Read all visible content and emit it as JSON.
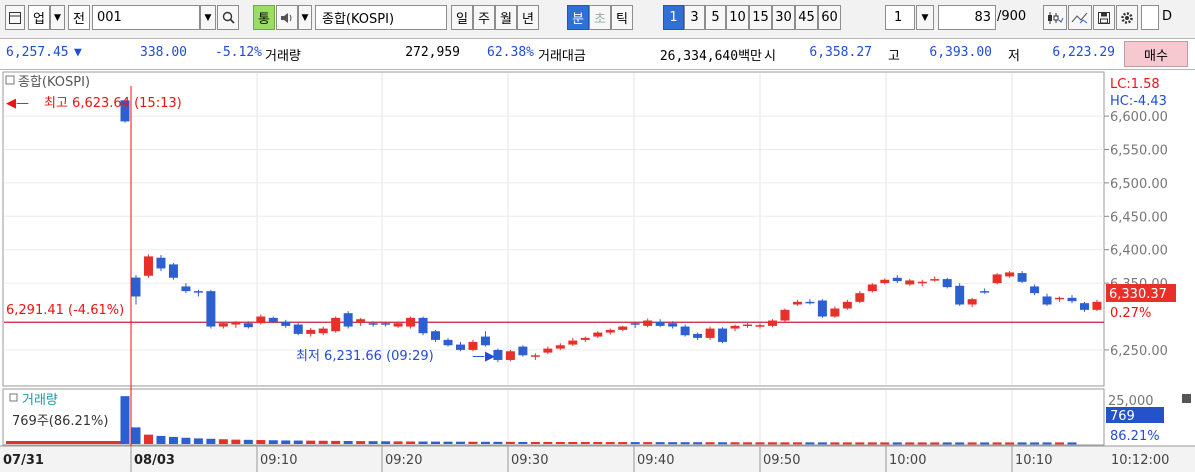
{
  "toolbar": {
    "col_label": "업",
    "prev_label": "전",
    "code": "001",
    "search_icon": "search-icon",
    "tong_label": "통",
    "name_value": "종합(KOSPI)",
    "periods": [
      "일",
      "주",
      "월",
      "년",
      "분",
      "초",
      "틱"
    ],
    "intervals": [
      "1",
      "3",
      "5",
      "10",
      "15",
      "30",
      "45",
      "60"
    ],
    "interval_value": "1",
    "count_value": "83",
    "count_total": "/900",
    "checkbox_label": "D"
  },
  "info": {
    "price": "6,257.45",
    "change_arrow": "▼",
    "change": "338.00",
    "change_pct": "-5.12%",
    "volume_label": "거래량",
    "volume": "272,959",
    "volume_pct": "62.38%",
    "amount_label": "거래대금",
    "amount": "26,334,640백만",
    "open_label": "시",
    "open": "6,358.27",
    "high_label": "고",
    "high": "6,393.00",
    "low_label": "저",
    "low": "6,223.29",
    "buy_label": "매수"
  },
  "chart_data": [
    {
      "type": "candlestick",
      "title": "종합(KOSPI)",
      "ylim": [
        6205,
        6645
      ],
      "yticks": [
        "6,600.00",
        "6,550.00",
        "6,500.00",
        "6,450.00",
        "6,400.00",
        "6,350.00",
        "6,250.00"
      ],
      "ytick_values": [
        6600,
        6550,
        6500,
        6450,
        6400,
        6350,
        6250
      ],
      "xticks": [
        "07/31",
        "08/03",
        "09:10",
        "09:20",
        "09:30",
        "09:40",
        "09:50",
        "10:00",
        "10:10",
        "10:12:00"
      ],
      "reference_line": {
        "value": 6291.41,
        "label": "6,291.41 (-4.61%)"
      },
      "high_annotation": "최고 6,623.64 (15:13)",
      "low_annotation": "최저 6,231.66 (09:29)",
      "current": {
        "value": 6330.37,
        "label": "6,330.37",
        "pct": "0.27%"
      },
      "lc_label": "LC:1.58",
      "hc_label": "HC:-4.43",
      "up_color": "#e8302a",
      "down_color": "#2c5fd0",
      "candles": [
        {
          "t": "15:13",
          "o": 6623.6,
          "h": 6623.6,
          "l": 6590,
          "c": 6592
        },
        {
          "t": "09:00",
          "o": 6358.3,
          "h": 6362,
          "l": 6318,
          "c": 6330
        },
        {
          "t": "09:01",
          "o": 6361,
          "h": 6393,
          "l": 6358,
          "c": 6390
        },
        {
          "t": "09:02",
          "o": 6388,
          "h": 6392,
          "l": 6368,
          "c": 6372
        },
        {
          "t": "09:03",
          "o": 6378,
          "h": 6380,
          "l": 6355,
          "c": 6358
        },
        {
          "t": "09:04",
          "o": 6345,
          "h": 6350,
          "l": 6335,
          "c": 6338
        },
        {
          "t": "09:05",
          "o": 6338,
          "h": 6340,
          "l": 6330,
          "c": 6336
        },
        {
          "t": "09:06",
          "o": 6338,
          "h": 6340,
          "l": 6282,
          "c": 6285
        },
        {
          "t": "09:07",
          "o": 6285,
          "h": 6292,
          "l": 6282,
          "c": 6290
        },
        {
          "t": "09:08",
          "o": 6288,
          "h": 6293,
          "l": 6283,
          "c": 6292
        },
        {
          "t": "09:09",
          "o": 6290,
          "h": 6293,
          "l": 6282,
          "c": 6284
        },
        {
          "t": "09:10",
          "o": 6290,
          "h": 6303,
          "l": 6288,
          "c": 6300
        },
        {
          "t": "09:11",
          "o": 6298,
          "h": 6300,
          "l": 6290,
          "c": 6292
        },
        {
          "t": "09:12",
          "o": 6292,
          "h": 6295,
          "l": 6283,
          "c": 6286
        },
        {
          "t": "09:13",
          "o": 6288,
          "h": 6290,
          "l": 6272,
          "c": 6274
        },
        {
          "t": "09:14",
          "o": 6274,
          "h": 6283,
          "l": 6270,
          "c": 6280
        },
        {
          "t": "09:15",
          "o": 6275,
          "h": 6285,
          "l": 6272,
          "c": 6282
        },
        {
          "t": "09:16",
          "o": 6278,
          "h": 6300,
          "l": 6276,
          "c": 6298
        },
        {
          "t": "09:17",
          "o": 6305,
          "h": 6308,
          "l": 6282,
          "c": 6285
        },
        {
          "t": "09:18",
          "o": 6292,
          "h": 6298,
          "l": 6286,
          "c": 6296
        },
        {
          "t": "09:19",
          "o": 6290,
          "h": 6293,
          "l": 6285,
          "c": 6288
        },
        {
          "t": "09:20",
          "o": 6290,
          "h": 6292,
          "l": 6285,
          "c": 6288
        },
        {
          "t": "09:21",
          "o": 6285,
          "h": 6292,
          "l": 6283,
          "c": 6290
        },
        {
          "t": "09:22",
          "o": 6285,
          "h": 6300,
          "l": 6282,
          "c": 6298
        },
        {
          "t": "09:23",
          "o": 6298,
          "h": 6300,
          "l": 6272,
          "c": 6275
        },
        {
          "t": "09:24",
          "o": 6278,
          "h": 6280,
          "l": 6262,
          "c": 6265
        },
        {
          "t": "09:25",
          "o": 6265,
          "h": 6268,
          "l": 6255,
          "c": 6257
        },
        {
          "t": "09:26",
          "o": 6258,
          "h": 6262,
          "l": 6248,
          "c": 6250
        },
        {
          "t": "09:27",
          "o": 6250,
          "h": 6265,
          "l": 6248,
          "c": 6262
        },
        {
          "t": "09:28",
          "o": 6270,
          "h": 6278,
          "l": 6255,
          "c": 6257
        },
        {
          "t": "09:29",
          "o": 6250,
          "h": 6252,
          "l": 6231.7,
          "c": 6235
        },
        {
          "t": "09:30",
          "o": 6235,
          "h": 6250,
          "l": 6233,
          "c": 6248
        },
        {
          "t": "09:31",
          "o": 6255,
          "h": 6257,
          "l": 6240,
          "c": 6242
        },
        {
          "t": "09:32",
          "o": 6240,
          "h": 6245,
          "l": 6235,
          "c": 6242
        },
        {
          "t": "09:33",
          "o": 6246,
          "h": 6255,
          "l": 6244,
          "c": 6252
        },
        {
          "t": "09:34",
          "o": 6252,
          "h": 6260,
          "l": 6250,
          "c": 6257
        },
        {
          "t": "09:35",
          "o": 6258,
          "h": 6268,
          "l": 6256,
          "c": 6264
        },
        {
          "t": "09:36",
          "o": 6265,
          "h": 6270,
          "l": 6262,
          "c": 6268
        },
        {
          "t": "09:37",
          "o": 6270,
          "h": 6278,
          "l": 6268,
          "c": 6276
        },
        {
          "t": "09:38",
          "o": 6276,
          "h": 6282,
          "l": 6273,
          "c": 6280
        },
        {
          "t": "09:39",
          "o": 6280,
          "h": 6286,
          "l": 6278,
          "c": 6285
        },
        {
          "t": "09:40",
          "o": 6290,
          "h": 6292,
          "l": 6283,
          "c": 6288
        },
        {
          "t": "09:41",
          "o": 6286,
          "h": 6297,
          "l": 6284,
          "c": 6294
        },
        {
          "t": "09:42",
          "o": 6292,
          "h": 6296,
          "l": 6284,
          "c": 6286
        },
        {
          "t": "09:43",
          "o": 6290,
          "h": 6293,
          "l": 6282,
          "c": 6285
        },
        {
          "t": "09:44",
          "o": 6285,
          "h": 6288,
          "l": 6270,
          "c": 6272
        },
        {
          "t": "09:45",
          "o": 6274,
          "h": 6276,
          "l": 6265,
          "c": 6268
        },
        {
          "t": "09:46",
          "o": 6268,
          "h": 6285,
          "l": 6265,
          "c": 6282
        },
        {
          "t": "09:47",
          "o": 6282,
          "h": 6284,
          "l": 6260,
          "c": 6262
        },
        {
          "t": "09:48",
          "o": 6282,
          "h": 6288,
          "l": 6278,
          "c": 6286
        },
        {
          "t": "09:49",
          "o": 6286,
          "h": 6290,
          "l": 6283,
          "c": 6288
        },
        {
          "t": "09:50",
          "o": 6285,
          "h": 6290,
          "l": 6282,
          "c": 6287
        },
        {
          "t": "09:51",
          "o": 6286,
          "h": 6296,
          "l": 6284,
          "c": 6294
        },
        {
          "t": "09:52",
          "o": 6294,
          "h": 6312,
          "l": 6292,
          "c": 6310
        },
        {
          "t": "09:53",
          "o": 6318,
          "h": 6325,
          "l": 6316,
          "c": 6322
        },
        {
          "t": "09:54",
          "o": 6322,
          "h": 6326,
          "l": 6318,
          "c": 6320
        },
        {
          "t": "09:55",
          "o": 6324,
          "h": 6326,
          "l": 6298,
          "c": 6300
        },
        {
          "t": "09:56",
          "o": 6300,
          "h": 6315,
          "l": 6298,
          "c": 6312
        },
        {
          "t": "09:57",
          "o": 6312,
          "h": 6325,
          "l": 6310,
          "c": 6322
        },
        {
          "t": "09:58",
          "o": 6322,
          "h": 6338,
          "l": 6320,
          "c": 6335
        },
        {
          "t": "09:59",
          "o": 6338,
          "h": 6350,
          "l": 6336,
          "c": 6348
        },
        {
          "t": "10:00",
          "o": 6350,
          "h": 6357,
          "l": 6348,
          "c": 6355
        },
        {
          "t": "10:01",
          "o": 6358,
          "h": 6362,
          "l": 6350,
          "c": 6353
        },
        {
          "t": "10:02",
          "o": 6348,
          "h": 6356,
          "l": 6346,
          "c": 6354
        },
        {
          "t": "10:03",
          "o": 6352,
          "h": 6355,
          "l": 6345,
          "c": 6352
        },
        {
          "t": "10:04",
          "o": 6355,
          "h": 6360,
          "l": 6352,
          "c": 6356
        },
        {
          "t": "10:05",
          "o": 6356,
          "h": 6358,
          "l": 6342,
          "c": 6344
        },
        {
          "t": "10:06",
          "o": 6346,
          "h": 6350,
          "l": 6316,
          "c": 6318
        },
        {
          "t": "10:07",
          "o": 6318,
          "h": 6328,
          "l": 6314,
          "c": 6326
        },
        {
          "t": "10:08",
          "o": 6338,
          "h": 6342,
          "l": 6334,
          "c": 6336
        },
        {
          "t": "10:09",
          "o": 6350,
          "h": 6365,
          "l": 6348,
          "c": 6363
        },
        {
          "t": "10:10",
          "o": 6360,
          "h": 6368,
          "l": 6358,
          "c": 6366
        },
        {
          "t": "10:11",
          "o": 6365,
          "h": 6368,
          "l": 6350,
          "c": 6352
        },
        {
          "t": "10:12",
          "o": 6345,
          "h": 6348,
          "l": 6332,
          "c": 6335
        },
        {
          "t": "10:13",
          "o": 6330,
          "h": 6334,
          "l": 6316,
          "c": 6318
        },
        {
          "t": "10:14",
          "o": 6326,
          "h": 6330,
          "l": 6322,
          "c": 6328
        },
        {
          "t": "10:15",
          "o": 6328,
          "h": 6332,
          "l": 6320,
          "c": 6323
        },
        {
          "t": "10:16",
          "o": 6320,
          "h": 6322,
          "l": 6307,
          "c": 6310
        },
        {
          "t": "10:17",
          "o": 6310,
          "h": 6325,
          "l": 6308,
          "c": 6322
        }
      ]
    },
    {
      "type": "bar",
      "title": "거래량",
      "label": "769주(86.21%)",
      "ytick": "25,000",
      "current_label": "769",
      "current_pct": "86.21%",
      "ylim": [
        0,
        25000
      ],
      "volumes": [
        23000,
        8000,
        4500,
        3900,
        3400,
        3000,
        2700,
        2500,
        2300,
        2100,
        2000,
        1900,
        1800,
        1700,
        1650,
        1600,
        1550,
        1500,
        1450,
        1400,
        1350,
        1300,
        1250,
        1200,
        1180,
        1150,
        1120,
        1100,
        1080,
        1060,
        1040,
        1020,
        1000,
        990,
        980,
        970,
        960,
        950,
        940,
        930,
        920,
        910,
        900,
        890,
        880,
        870,
        860,
        850,
        840,
        830,
        820,
        815,
        810,
        805,
        800,
        795,
        790,
        785,
        780,
        778,
        776,
        774,
        772,
        771,
        770,
        769,
        769,
        769,
        769,
        769,
        769,
        769,
        769,
        769,
        769,
        769,
        769
      ]
    }
  ]
}
